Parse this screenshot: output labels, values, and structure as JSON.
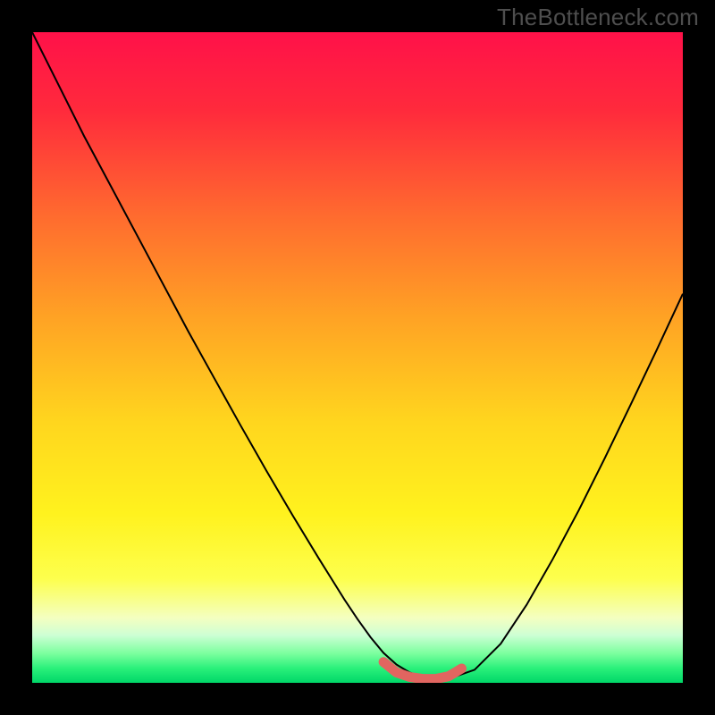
{
  "watermark": "TheBottleneck.com",
  "colors": {
    "frame": "#000000",
    "gradient_stops": [
      {
        "offset": 0.0,
        "color": "#ff1149"
      },
      {
        "offset": 0.12,
        "color": "#ff2a3c"
      },
      {
        "offset": 0.28,
        "color": "#ff6a2f"
      },
      {
        "offset": 0.44,
        "color": "#ffa324"
      },
      {
        "offset": 0.6,
        "color": "#ffd61e"
      },
      {
        "offset": 0.74,
        "color": "#fff21e"
      },
      {
        "offset": 0.84,
        "color": "#fdff4d"
      },
      {
        "offset": 0.9,
        "color": "#f4ffc0"
      },
      {
        "offset": 0.927,
        "color": "#cdffd4"
      },
      {
        "offset": 0.955,
        "color": "#7bff9e"
      },
      {
        "offset": 0.978,
        "color": "#29f07a"
      },
      {
        "offset": 1.0,
        "color": "#00d768"
      }
    ],
    "curve_stroke": "#000000",
    "marker_stroke": "#e16560",
    "marker_fill": "none"
  },
  "chart_data": {
    "type": "line",
    "title": "",
    "xlabel": "",
    "ylabel": "",
    "xlim": [
      0,
      100
    ],
    "ylim": [
      0,
      100
    ],
    "grid": false,
    "legend": false,
    "series": [
      {
        "name": "bottleneck-curve",
        "x": [
          0,
          4,
          8,
          12,
          16,
          20,
          24,
          28,
          32,
          36,
          40,
          44,
          48,
          50,
          52,
          54,
          56,
          58,
          60,
          62,
          64,
          68,
          72,
          76,
          80,
          84,
          88,
          92,
          96,
          100
        ],
        "y": [
          100,
          92,
          84,
          76.5,
          69,
          61.5,
          54,
          46.8,
          39.6,
          32.6,
          25.8,
          19.2,
          12.8,
          9.8,
          7.0,
          4.6,
          2.8,
          1.6,
          0.9,
          0.6,
          0.6,
          2.0,
          6.0,
          12.0,
          19.0,
          26.5,
          34.5,
          42.8,
          51.2,
          59.8
        ]
      }
    ],
    "marker": {
      "name": "optimal-range",
      "x": [
        54,
        56,
        58,
        60,
        62,
        64,
        66
      ],
      "y": [
        3.2,
        1.6,
        0.9,
        0.6,
        0.6,
        1.0,
        2.2
      ]
    }
  }
}
